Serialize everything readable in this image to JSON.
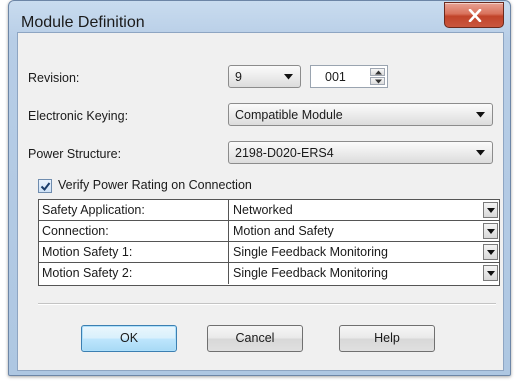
{
  "window": {
    "title": "Module Definition"
  },
  "fields": {
    "revision": {
      "label": "Revision:",
      "major": "9",
      "minor": "001"
    },
    "keying": {
      "label": "Electronic Keying:",
      "value": "Compatible Module"
    },
    "power": {
      "label": "Power Structure:",
      "value": "2198-D020-ERS4"
    }
  },
  "verify": {
    "label": "Verify Power Rating on Connection",
    "checked": true
  },
  "grid": {
    "rows": [
      {
        "name": "Safety Application:",
        "value": "Networked"
      },
      {
        "name": "Connection:",
        "value": "Motion and Safety"
      },
      {
        "name": "Motion Safety 1:",
        "value": "Single Feedback Monitoring"
      },
      {
        "name": "Motion Safety 2:",
        "value": "Single Feedback Monitoring"
      }
    ]
  },
  "buttons": {
    "ok": "OK",
    "cancel": "Cancel",
    "help": "Help"
  },
  "colors": {
    "close": "#c9573e",
    "default_button_border": "#3c7fb1"
  }
}
